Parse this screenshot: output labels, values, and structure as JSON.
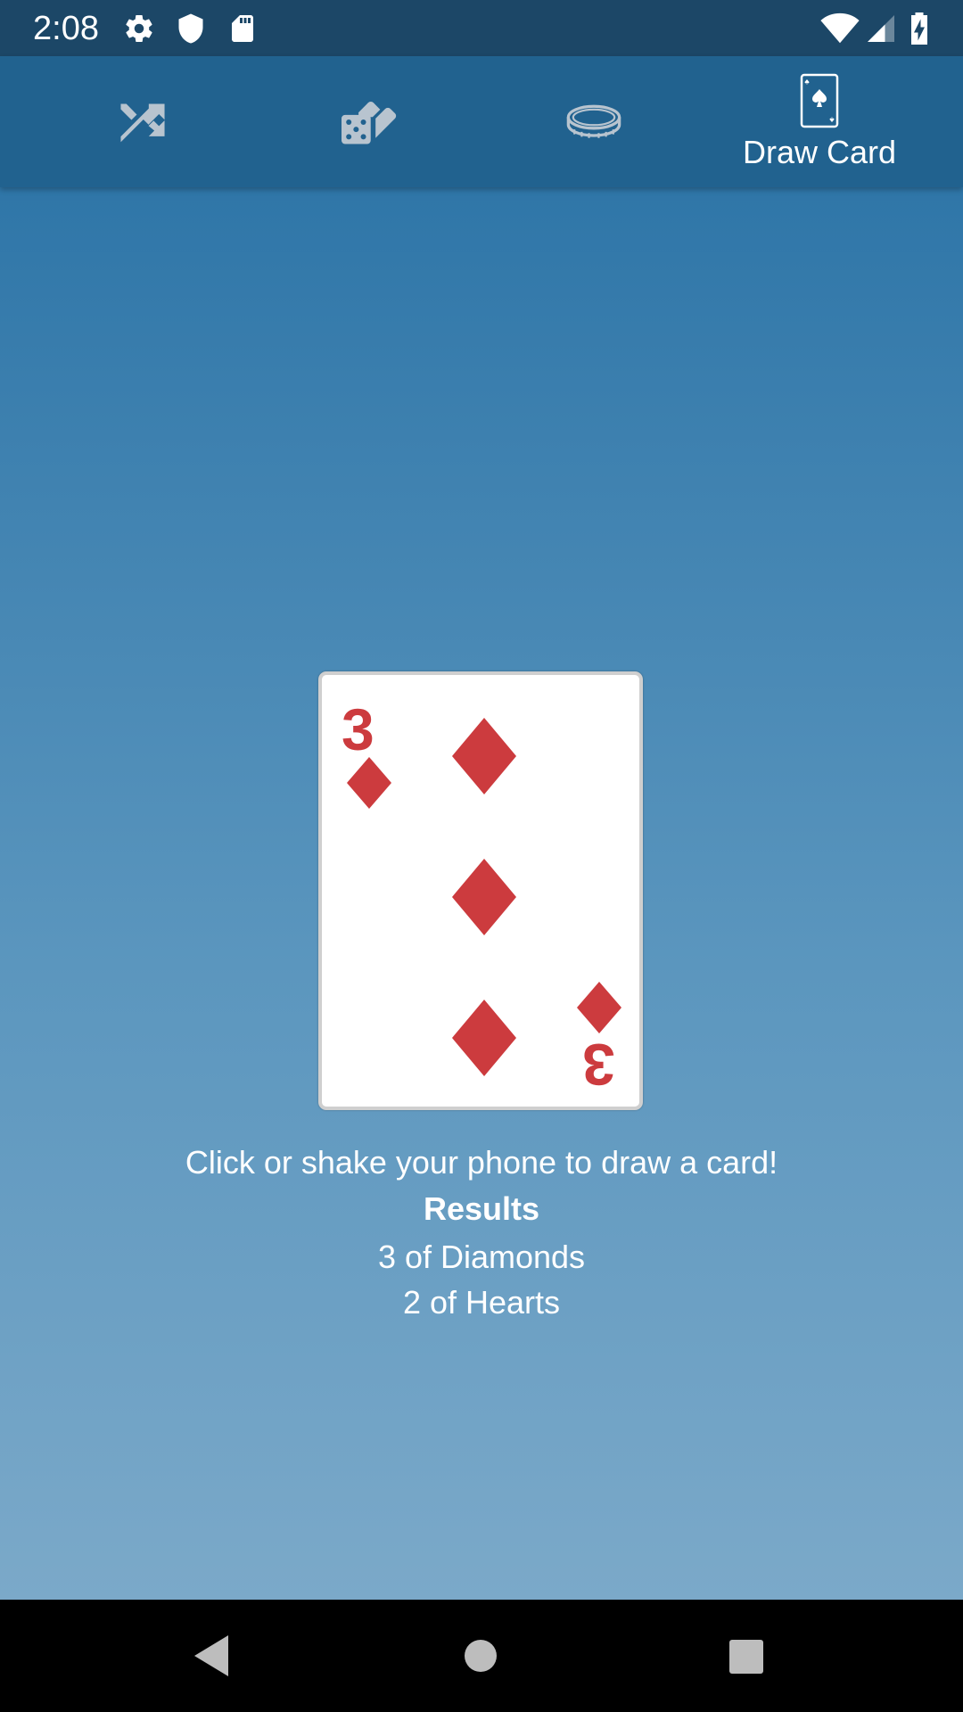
{
  "status_bar": {
    "time": "2:08",
    "icons": [
      "settings-icon",
      "shield-icon",
      "sd-card-icon",
      "wifi-icon",
      "signal-icon",
      "battery-charging-icon"
    ]
  },
  "tabs": [
    {
      "name": "shuffle",
      "icon": "shuffle-icon",
      "label": ""
    },
    {
      "name": "dice",
      "icon": "dice-icon",
      "label": ""
    },
    {
      "name": "coin",
      "icon": "coin-icon",
      "label": ""
    },
    {
      "name": "draw-card",
      "icon": "playing-card-icon",
      "label": "Draw Card",
      "active": true
    }
  ],
  "card": {
    "rank": "3",
    "suit": "Diamonds",
    "color": "#cc3b3e"
  },
  "hint": "Click or shake your phone to draw a card!",
  "results": {
    "title": "Results",
    "items": [
      "3 of Diamonds",
      "2 of Hearts"
    ]
  },
  "nav": {
    "buttons": [
      "back-icon",
      "home-icon",
      "recents-icon"
    ]
  },
  "colors": {
    "status_bar": "#1c4767",
    "tab_bar": "#21628f",
    "inactive_icon": "#b8c4cf",
    "diamond_red": "#cc3b3e"
  }
}
